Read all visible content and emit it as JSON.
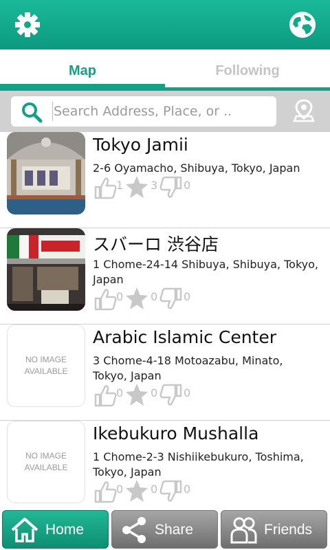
{
  "header": {
    "settings_icon": "gear-icon",
    "language_icon": "globe-icon",
    "accent_color": "#12a086"
  },
  "tabs": [
    {
      "label": "Map",
      "active": true
    },
    {
      "label": "Following",
      "active": false
    }
  ],
  "search": {
    "placeholder": "Search Address, Place, or ..",
    "value": ""
  },
  "places": [
    {
      "name": "Tokyo Jamii",
      "address": "2-6 Oyamacho, Shibuya, Tokyo, Japan",
      "likes": "1",
      "stars": "3",
      "dislikes": "0",
      "image": "mosque-interior-photo",
      "image_line1": "",
      "image_line2": ""
    },
    {
      "name": "スバーロ 渋谷店",
      "address": "1 Chome-24-14 Shibuya, Shibuya, Tokyo, Japan",
      "likes": "0",
      "stars": "0",
      "dislikes": "0",
      "image": "storefront-photo",
      "image_line1": "",
      "image_line2": ""
    },
    {
      "name": "Arabic Islamic Center",
      "address": "3 Chome-4-18 Motoazabu, Minato, Tokyo, Japan",
      "likes": "0",
      "stars": "0",
      "dislikes": "0",
      "image": "no-image-placeholder",
      "image_line1": "NO IMAGE",
      "image_line2": "AVAILABLE"
    },
    {
      "name": "Ikebukuro Mushalla",
      "address": "1 Chome-2-3 Nishiikebukuro, Toshima, Tokyo, Japan",
      "likes": "0",
      "stars": "0",
      "dislikes": "0",
      "image": "no-image-placeholder",
      "image_line1": "NO IMAGE",
      "image_line2": "AVAILABLE"
    }
  ],
  "bottom_nav": [
    {
      "label": "Home",
      "icon": "home-icon",
      "active": true
    },
    {
      "label": "Share",
      "icon": "share-icon",
      "active": false
    },
    {
      "label": "Friends",
      "icon": "friends-icon",
      "active": false
    }
  ]
}
